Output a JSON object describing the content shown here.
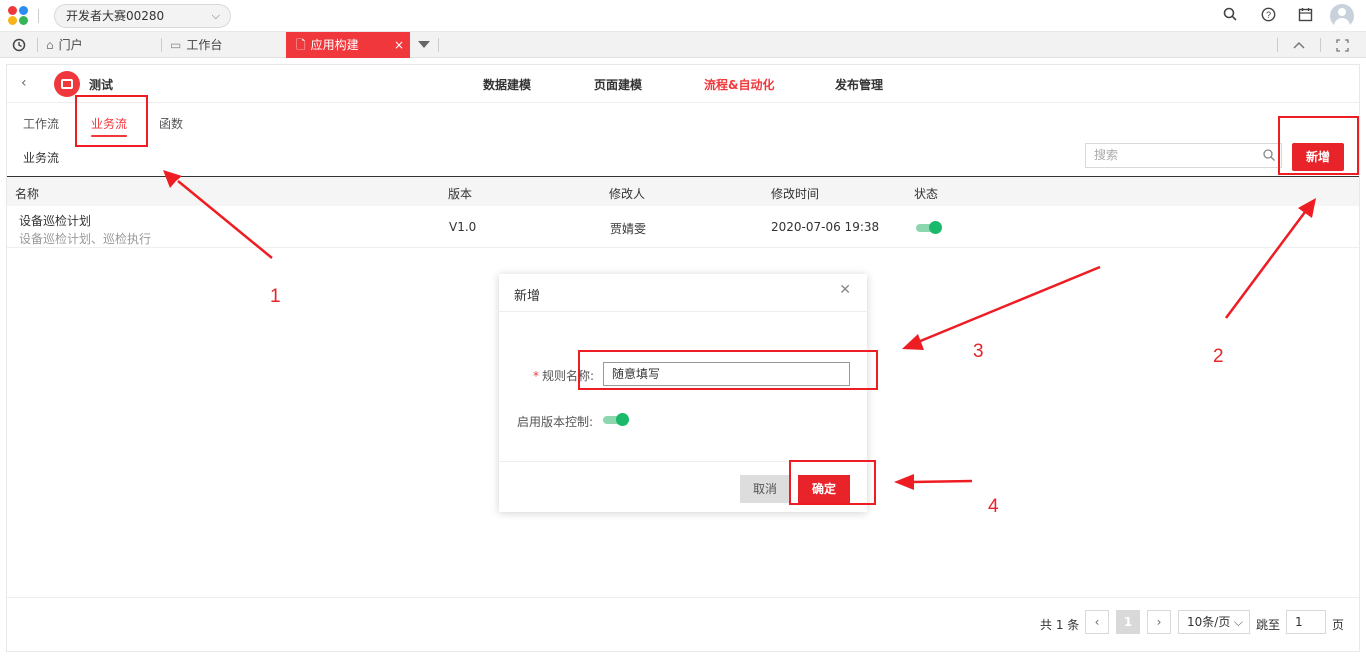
{
  "topbar": {
    "org_name": "开发者大赛00280",
    "icons": [
      "search-icon",
      "help-icon",
      "calendar-icon",
      "avatar"
    ]
  },
  "tabs": {
    "history_icon": "history-icon",
    "items": [
      {
        "label": "门户",
        "icon": "home-icon"
      },
      {
        "label": "工作台",
        "icon": "monitor-icon"
      },
      {
        "label": "应用构建",
        "icon": "document-icon",
        "active": true
      }
    ],
    "close": "×"
  },
  "app": {
    "name": "测试",
    "nav": [
      "数据建模",
      "页面建模",
      "流程&自动化",
      "发布管理"
    ],
    "active_nav": "流程&自动化"
  },
  "subtabs": [
    "工作流",
    "业务流",
    "函数"
  ],
  "active_subtab": "业务流",
  "section_title": "业务流",
  "search": {
    "placeholder": "搜索"
  },
  "new_button": "新增",
  "table": {
    "columns": [
      "名称",
      "版本",
      "修改人",
      "修改时间",
      "状态"
    ],
    "rows": [
      {
        "name": "设备巡检计划",
        "desc": "设备巡检计划、巡检执行",
        "version": "V1.0",
        "modifier": "贾婧雯",
        "time": "2020-07-06 19:38",
        "enabled": true
      }
    ]
  },
  "pagination": {
    "total": "共 1 条",
    "current": "1",
    "page_size": "10条/页",
    "goto_label": "跳至",
    "goto_value": "1",
    "page_unit": "页"
  },
  "modal": {
    "title": "新增",
    "rule_name_label": "规则名称:",
    "rule_name_value": "随意填写",
    "version_control_label": "启用版本控制:",
    "version_control_enabled": true,
    "cancel": "取消",
    "ok": "确定"
  },
  "annotations": [
    "1",
    "2",
    "3",
    "4"
  ],
  "colors": {
    "accent": "#f0383c",
    "toggle_on": "#1bb96b"
  }
}
